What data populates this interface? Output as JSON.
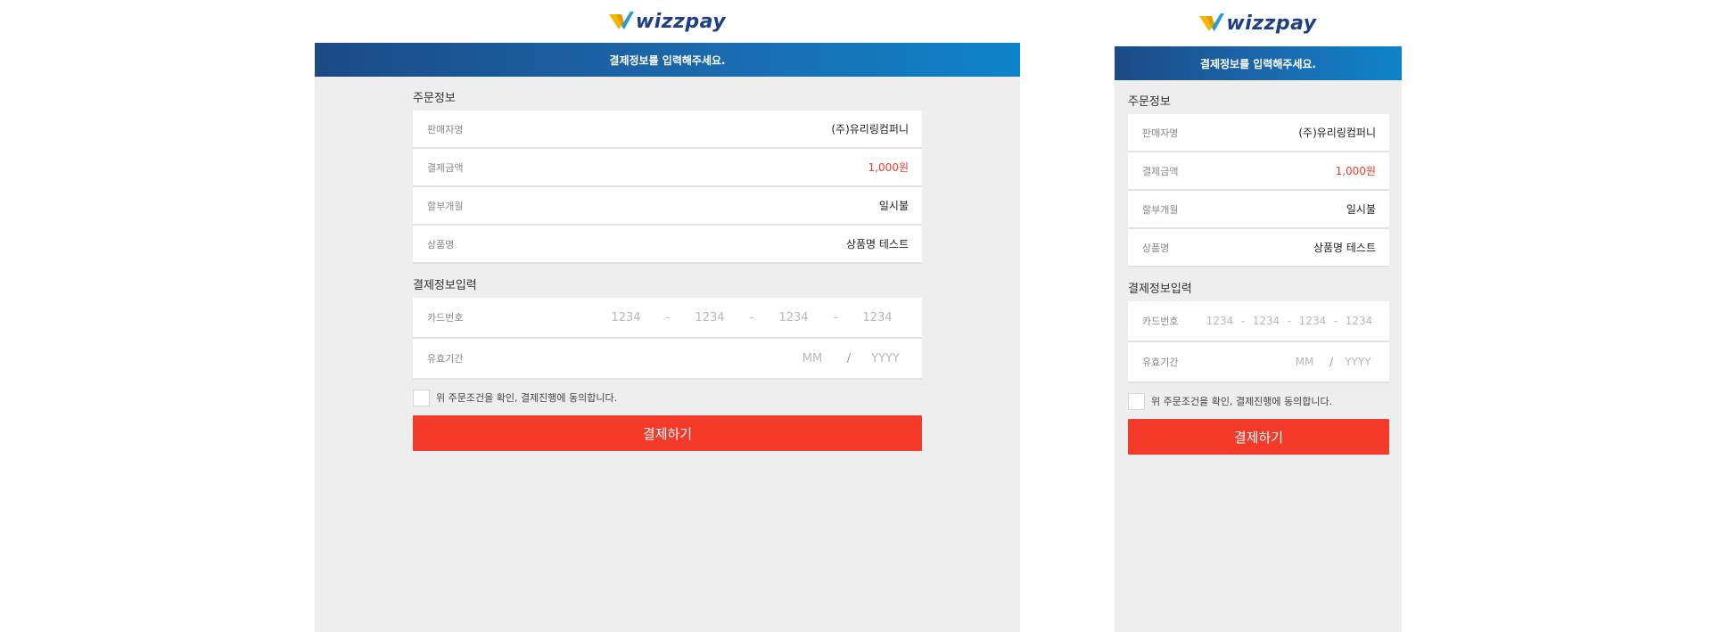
{
  "brand": {
    "name": "wizzpay",
    "accent": "#1e3f85",
    "mark_colors": [
      "#f5b800",
      "#2a9bd8"
    ]
  },
  "banner": {
    "text": "결제정보를 입력해주세요.",
    "gradient": [
      "#1b4a86",
      "#0d83c9"
    ]
  },
  "order_section": {
    "title": "주문정보",
    "rows": [
      {
        "label": "판매자명",
        "value": "(주)유리링컴퍼니"
      },
      {
        "label": "결제금액",
        "value": "1,000원"
      },
      {
        "label": "할부개월",
        "value": "일시불"
      },
      {
        "label": "상품명",
        "value": "상품명 테스트"
      }
    ]
  },
  "payment_section": {
    "title": "결제정보입력",
    "card": {
      "label": "카드번호",
      "placeholders": [
        "1234",
        "1234",
        "1234",
        "1234"
      ],
      "separator": "-"
    },
    "expiry": {
      "label": "유효기간",
      "month_placeholder": "MM",
      "year_placeholder": "YYYY",
      "separator": "/"
    }
  },
  "agreement": {
    "text": "위 주문조건을 확인, 결제진행에 동의합니다.",
    "checked": false
  },
  "pay_button": {
    "label": "결제하기",
    "color": "#f53a2a"
  },
  "price_color": "#f03a2a"
}
